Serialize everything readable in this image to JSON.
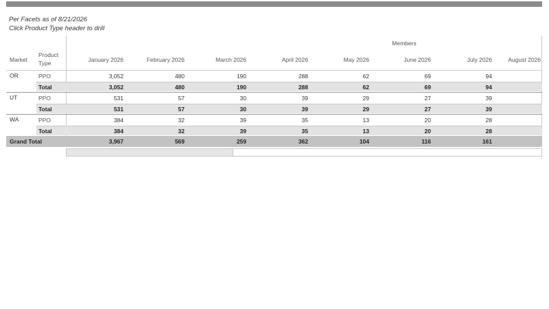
{
  "caption": {
    "line1": "Per Facets as of 8/21/2026",
    "line2": "Click Product Type header to drill"
  },
  "table": {
    "measure_header": "Members",
    "row_headers": {
      "market": "Market",
      "product_type": "Product Type"
    },
    "months": [
      "January 2026",
      "February 2026",
      "March 2026",
      "April 2026",
      "May 2026",
      "June 2026",
      "July 2026",
      "August 2026"
    ],
    "groups": [
      {
        "market": "OR",
        "detail": {
          "label": "PPO",
          "values": [
            "3,052",
            "480",
            "190",
            "288",
            "62",
            "69",
            "94",
            ""
          ]
        },
        "total": {
          "label": "Total",
          "values": [
            "3,052",
            "480",
            "190",
            "288",
            "62",
            "69",
            "94",
            ""
          ]
        }
      },
      {
        "market": "UT",
        "detail": {
          "label": "PPO",
          "values": [
            "531",
            "57",
            "30",
            "39",
            "29",
            "27",
            "39",
            ""
          ]
        },
        "total": {
          "label": "Total",
          "values": [
            "531",
            "57",
            "30",
            "39",
            "29",
            "27",
            "39",
            ""
          ]
        }
      },
      {
        "market": "WA",
        "detail": {
          "label": "PPO",
          "values": [
            "384",
            "32",
            "39",
            "35",
            "13",
            "20",
            "28",
            ""
          ]
        },
        "total": {
          "label": "Total",
          "values": [
            "384",
            "32",
            "39",
            "35",
            "13",
            "20",
            "28",
            ""
          ]
        }
      }
    ],
    "grand_total": {
      "label": "Grand Total",
      "values": [
        "3,967",
        "569",
        "259",
        "362",
        "104",
        "116",
        "161",
        ""
      ]
    }
  },
  "scrollbar": {
    "position": 0.0,
    "visible_fraction": 0.35
  },
  "colors": {
    "top_bar": "#8c8c8c",
    "total_band": "#e3e3e3",
    "grand_band": "#c2c2c2"
  }
}
